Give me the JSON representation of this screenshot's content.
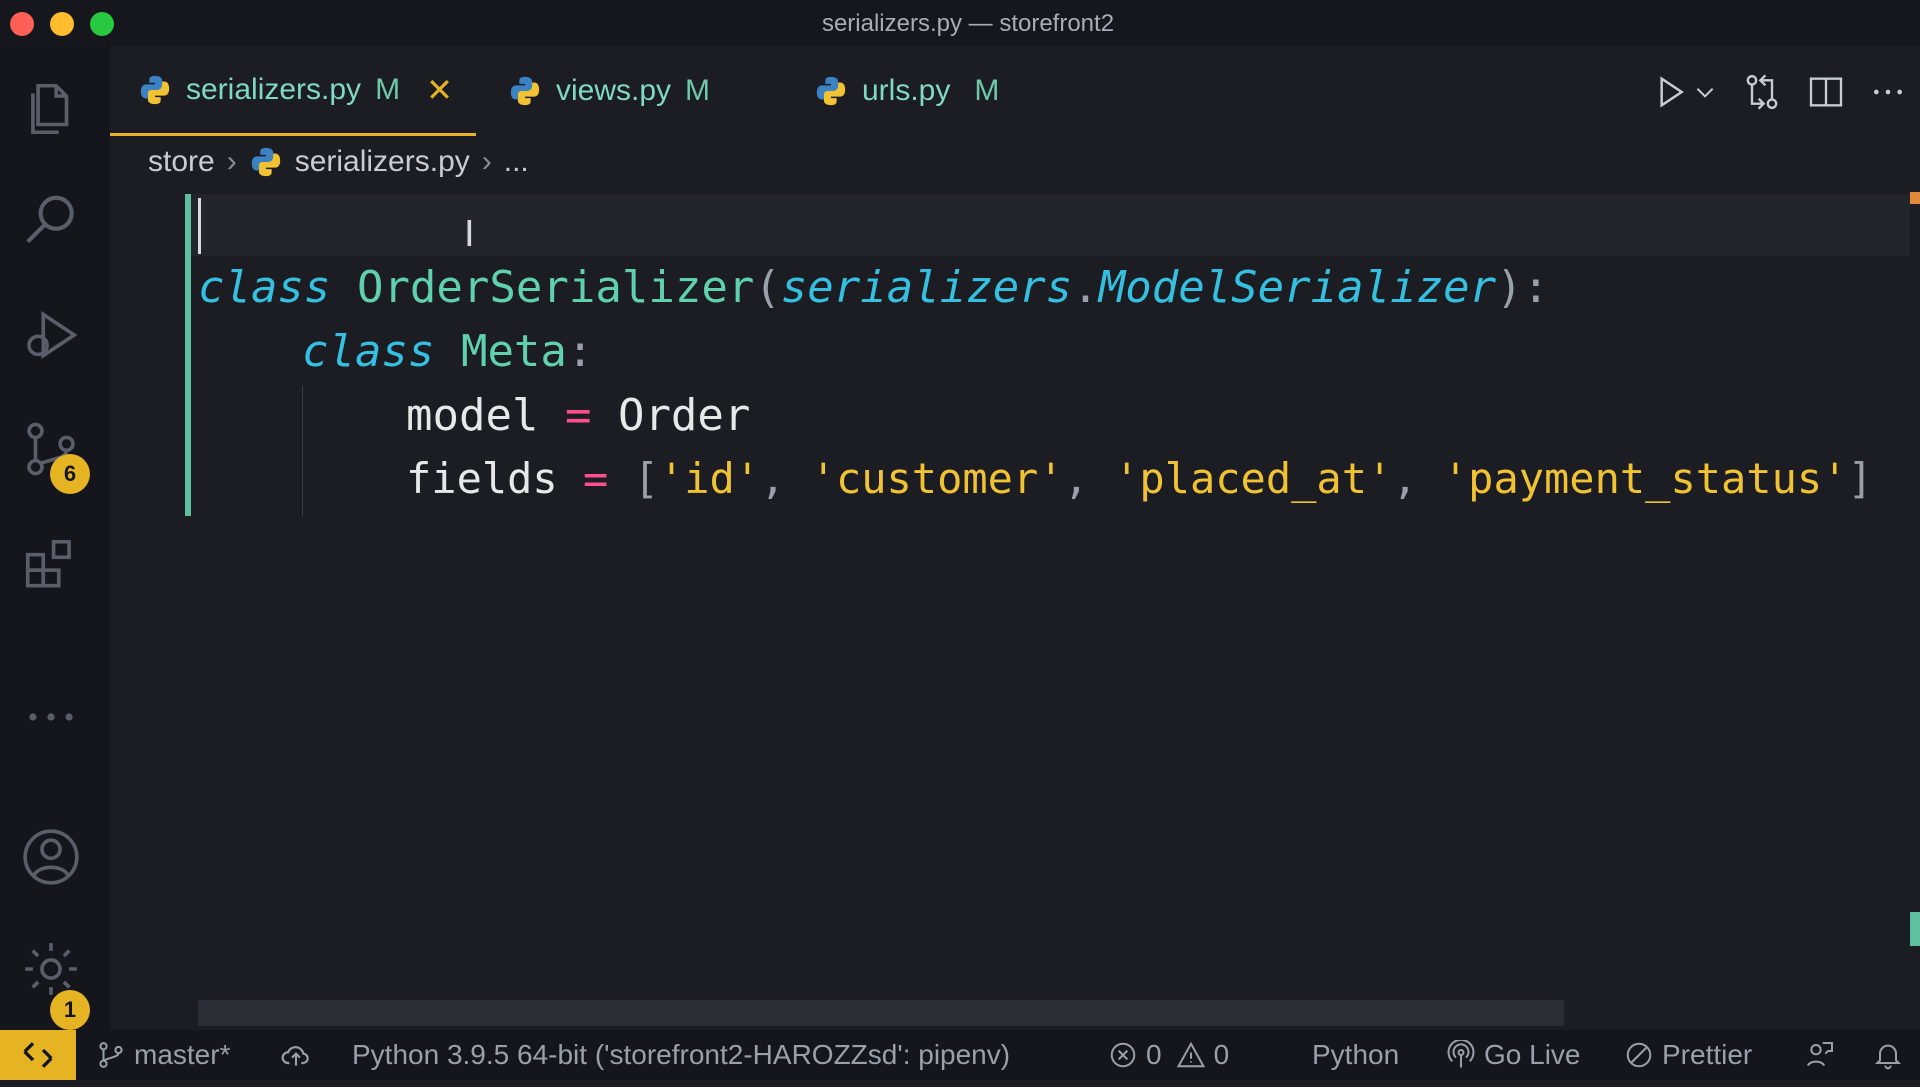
{
  "window": {
    "title": "serializers.py — storefront2"
  },
  "activity_bar": {
    "source_control_badge": "6",
    "settings_badge": "1"
  },
  "tabs": [
    {
      "label": "serializers.py",
      "modified": "M",
      "close": "✕"
    },
    {
      "label": "views.py",
      "modified": "M"
    },
    {
      "label": "urls.py",
      "modified": "M"
    }
  ],
  "breadcrumb": {
    "folder": "store",
    "file": "serializers.py",
    "more": "..."
  },
  "editor": {
    "line2": {
      "kw": "class",
      "name": "OrderSerializer",
      "open": "(",
      "module": "serializers",
      "dot": ".",
      "base": "ModelSerializer",
      "close": "):"
    },
    "line3": {
      "kw": "class",
      "name": "Meta",
      "colon": ":"
    },
    "line4": {
      "name": "model",
      "op": "=",
      "value": "Order"
    },
    "line5": {
      "name": "fields",
      "op": "=",
      "open": "[",
      "items": [
        "'id'",
        "'customer'",
        "'placed_at'",
        "'payment_status'"
      ],
      "sep": ",",
      "close": "]"
    }
  },
  "status_bar": {
    "branch": "master*",
    "interpreter": "Python 3.9.5 64-bit ('storefront2-HAROZZsd': pipenv)",
    "errors": "0",
    "warnings": "0",
    "language": "Python",
    "go_live": "Go Live",
    "prettier": "Prettier"
  },
  "colors": {
    "accent": "#e6b422",
    "keyword": "#34c0e0",
    "class_name": "#5fd0b0",
    "string": "#f1c232",
    "operator": "#ff4f8b"
  }
}
